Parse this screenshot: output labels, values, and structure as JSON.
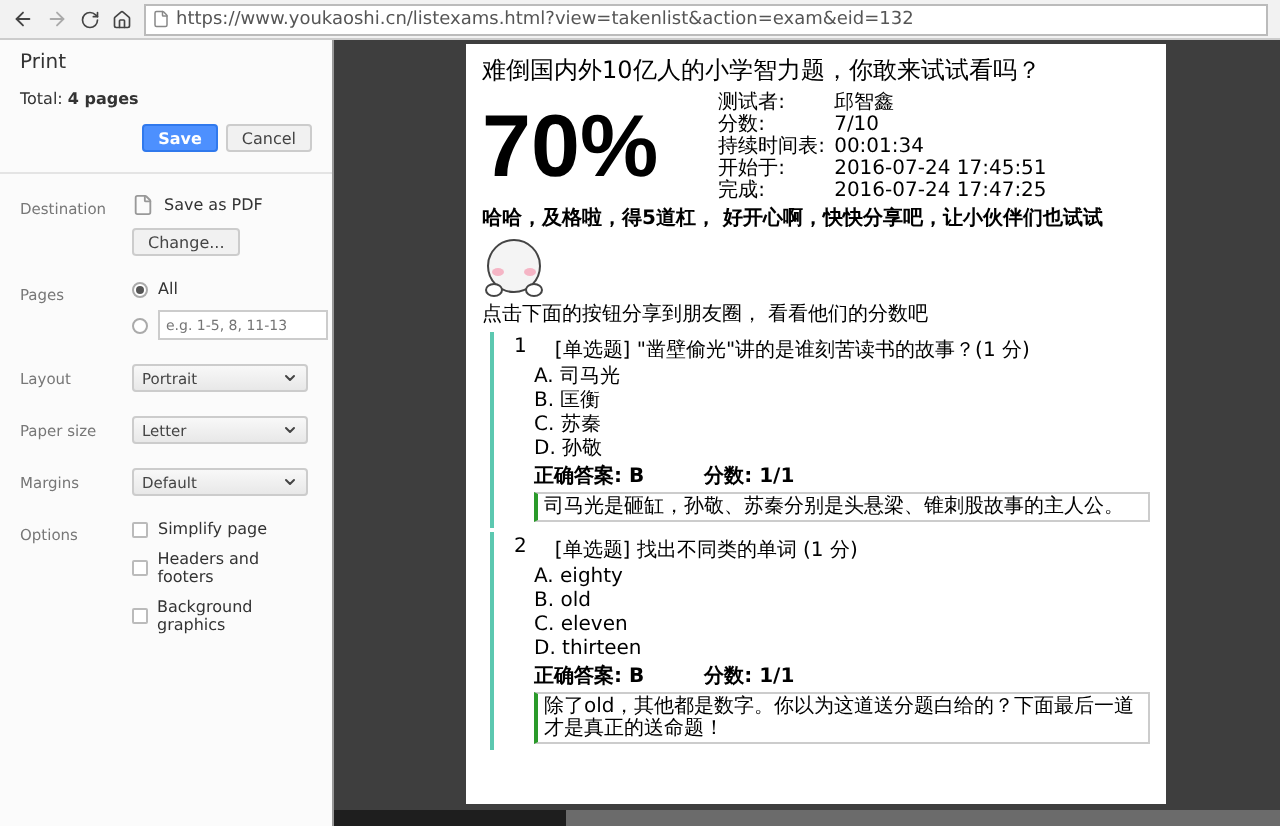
{
  "browser": {
    "url": "https://www.youkaoshi.cn/listexams.html?view=takenlist&action=exam&eid=132"
  },
  "print_panel": {
    "title": "Print",
    "total": "Total: **4 pages**",
    "buttons": [
      {
        "kind": "primary",
        "label": "Save"
      },
      {
        "kind": "secondary",
        "label": "Cancel"
      }
    ],
    "destination": {
      "label": "Destination",
      "name": "Save as PDF",
      "change": "Change..."
    },
    "pages": {
      "label": "Pages",
      "options": [
        {
          "kind": "all",
          "label": "All",
          "selected": true
        },
        {
          "kind": "range",
          "placeholder": "e.g. 1-5, 8, 11-13",
          "selected": false
        }
      ]
    },
    "selects": [
      {
        "label": "Layout",
        "value": "Portrait"
      },
      {
        "label": "Paper size",
        "value": "Letter"
      },
      {
        "label": "Margins",
        "value": "Default"
      }
    ],
    "options": {
      "label": "Options",
      "items": [
        {
          "label": "Simplify page",
          "checked": false
        },
        {
          "label": "Headers and footers",
          "checked": false
        },
        {
          "label": "Background graphics",
          "checked": false
        }
      ]
    }
  },
  "preview": {
    "title": "难倒国内外10亿人的小学智力题，你敢来试试看吗？",
    "score": "70%",
    "stats": [
      {
        "label": "测试者:",
        "value": "邱智鑫"
      },
      {
        "label": "分数:",
        "value": "7/10"
      },
      {
        "label": "持续时间表:",
        "value": "00:01:34"
      },
      {
        "label": "开始于:",
        "value": "2016-07-24 17:45:51"
      },
      {
        "label": "完成:",
        "value": "2016-07-24 17:47:25"
      }
    ],
    "message": "哈哈，及格啦，得5道杠， 好开心啊，快快分享吧，让小伙伴们也试试",
    "share_prompt": "点击下面的按钮分享到朋友圈， 看看他们的分数吧",
    "questions": [
      {
        "number": "1",
        "text": "[单选题] \"凿壁偷光\"讲的是谁刻苦读书的故事？(1 分)",
        "options": [
          "A. 司马光",
          "B. 匡衡",
          "C. 苏秦",
          "D. 孙敬"
        ],
        "answer_label": "正确答案: B",
        "score": "分数: 1/1",
        "explanation": "司马光是砸缸，孙敬、苏秦分别是头悬梁、锥刺股故事的主人公。"
      },
      {
        "number": "2",
        "text": "[单选题] 找出不同类的单词 (1 分)",
        "options": [
          "A. eighty",
          "B. old",
          "C. eleven",
          "D. thirteen"
        ],
        "answer_label": "正确答案: B",
        "score": "分数: 1/1",
        "explanation": "除了old，其他都是数字。你以为这道送分题白给的？下面最后一道才是真正的送命题！"
      }
    ]
  }
}
